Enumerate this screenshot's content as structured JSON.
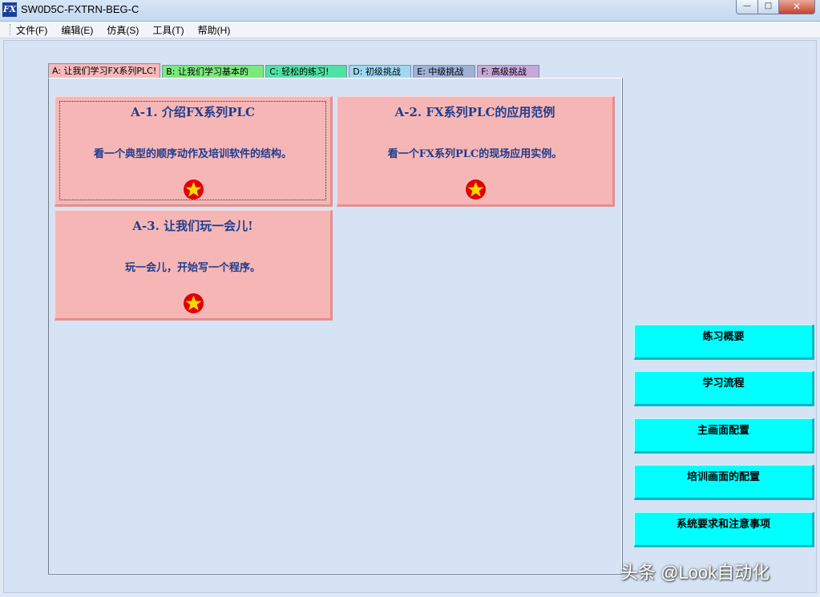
{
  "window": {
    "title": "SW0D5C-FXTRN-BEG-C",
    "icon": "fx-app-icon",
    "icon_text": "FX",
    "min_glyph": "—",
    "max_glyph": "□",
    "close_glyph": "✕"
  },
  "menu": [
    "文件(F)",
    "编辑(E)",
    "仿真(S)",
    "工具(T)",
    "帮助(H)"
  ],
  "tabs": [
    {
      "label": "A: 让我们学习FX系列PLC!",
      "color": "#f6b9b9"
    },
    {
      "label": "B: 让我们学习基本的",
      "color": "#7ce97c"
    },
    {
      "label": "C: 轻松的练习!",
      "color": "#4ee2a4"
    },
    {
      "label": "D: 初级挑战",
      "color": "#9fd8f2"
    },
    {
      "label": "E: 中级挑战",
      "color": "#9fb1d7"
    },
    {
      "label": "F: 高级挑战",
      "color": "#c6a8d9"
    }
  ],
  "cards": [
    {
      "title": "A-1. 介绍FX系列PLC",
      "desc": "看一个典型的顺序动作及培训软件的结构。",
      "icon": "star-icon"
    },
    {
      "title": "A-2. FX系列PLC的应用范例",
      "desc": "看一个FX系列PLC的现场应用实例。",
      "icon": "star-icon"
    },
    {
      "title": "A-3. 让我们玩一会儿!",
      "desc": "玩一会儿，开始写一个程序。",
      "icon": "star-icon"
    }
  ],
  "side_buttons": [
    "练习概要",
    "学习流程",
    "主画面配置",
    "培训画面的配置",
    "系统要求和注意事项"
  ],
  "watermark": "头条 @Look自动化",
  "colors": {
    "card": "#f6b6b6",
    "card_text": "#1f3d8c",
    "side_button": "#00ffff",
    "star": "#ffd700",
    "star_ring": "#e00000"
  }
}
